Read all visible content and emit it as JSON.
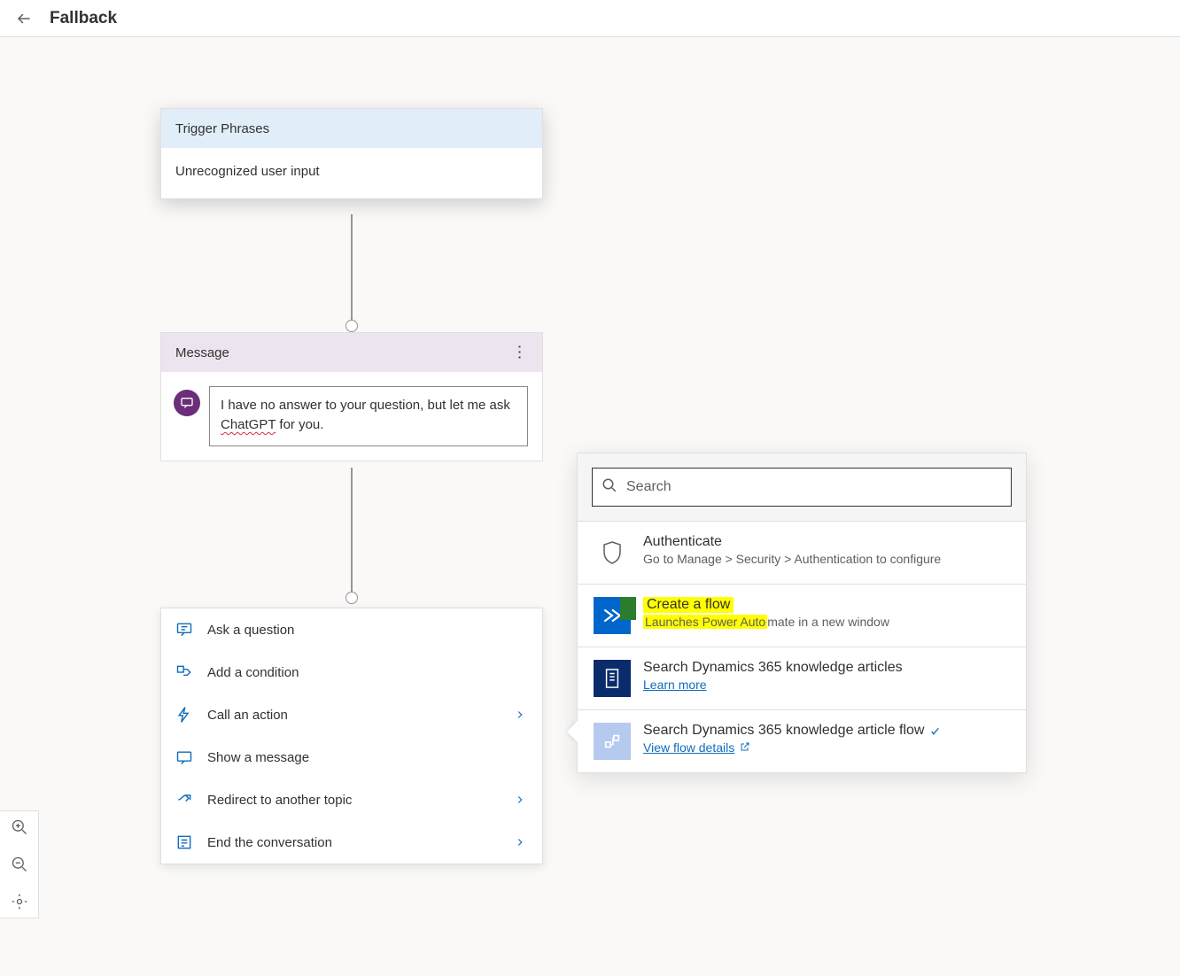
{
  "header": {
    "title": "Fallback"
  },
  "trigger_card": {
    "header": "Trigger Phrases",
    "body": "Unrecognized user input"
  },
  "message_card": {
    "header": "Message",
    "text_pre": "I have no answer to your question, but let me ask ",
    "spellcheck_word": "ChatGPT",
    "text_post": " for you."
  },
  "action_menu": {
    "items": [
      {
        "icon": "question-icon",
        "label": "Ask a question",
        "chevron": false
      },
      {
        "icon": "branch-icon",
        "label": "Add a condition",
        "chevron": false
      },
      {
        "icon": "bolt-icon",
        "label": "Call an action",
        "chevron": true
      },
      {
        "icon": "chat-icon",
        "label": "Show a message",
        "chevron": false
      },
      {
        "icon": "redirect-icon",
        "label": "Redirect to another topic",
        "chevron": true
      },
      {
        "icon": "list-icon",
        "label": "End the conversation",
        "chevron": true
      }
    ]
  },
  "flyout": {
    "search_placeholder": "Search",
    "authenticate": {
      "title": "Authenticate",
      "sub": "Go to Manage > Security > Authentication to configure"
    },
    "create_flow": {
      "title": "Create a flow",
      "sub_pre_hl": "Launches Power Auto",
      "sub_post_hl": "mate in a new window"
    },
    "search_kb": {
      "title": "Search Dynamics 365 knowledge articles",
      "link": "Learn more"
    },
    "search_flow": {
      "title": "Search Dynamics 365 knowledge article flow",
      "link": "View flow details"
    }
  }
}
